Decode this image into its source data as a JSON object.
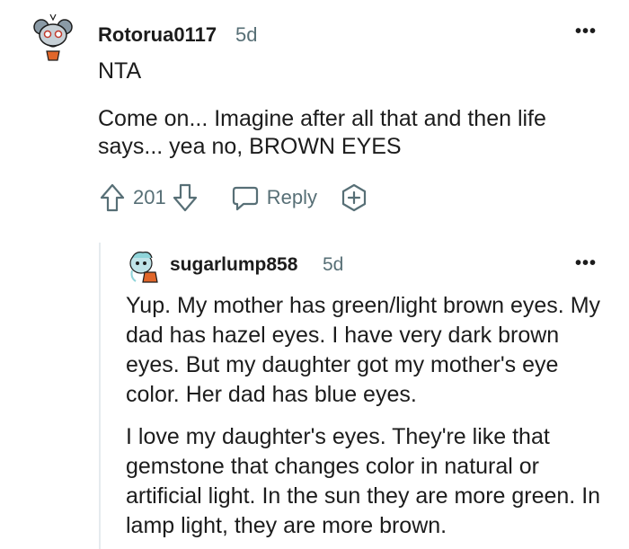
{
  "comment1": {
    "username": "Rotorua0117",
    "age": "5d",
    "more_label": "•••",
    "paragraphs": [
      "NTA",
      "Come on... Imagine after all that and then life says... yea no, BROWN EYES"
    ],
    "score": "201",
    "reply_label": "Reply"
  },
  "comment2": {
    "username": "sugarlump858",
    "age": "5d",
    "more_label": "•••",
    "paragraphs": [
      "Yup. My mother has green/light brown eyes. My dad has hazel eyes. I have very dark brown eyes. But my daughter got my mother's eye color. Her dad has blue eyes.",
      "I love my daughter's eyes. They're like that gemstone that changes color in natural or artificial light. In the sun they are more green. In lamp light, they are more brown."
    ]
  },
  "colors": {
    "meta": "#576f76",
    "text": "#1c1c1c",
    "thread": "#e5ebee"
  }
}
